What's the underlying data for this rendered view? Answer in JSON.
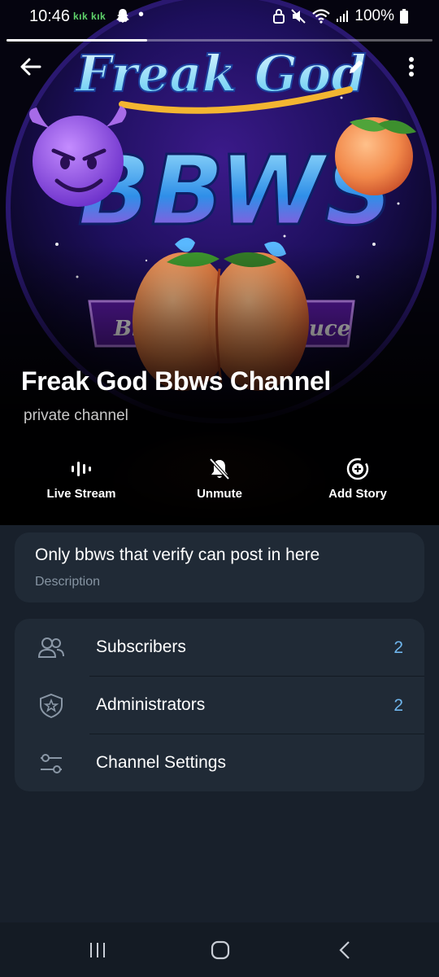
{
  "status_bar": {
    "time": "10:46",
    "kik_badges": "kık kık",
    "battery_text": "100%"
  },
  "story_progress": 0.33,
  "cover_art": {
    "logo_line1": "Freak God",
    "logo_line2": "BBWS",
    "banner_visible_left": "Bl",
    "banner_visible_right": "uce"
  },
  "channel": {
    "name": "Freak God Bbws Channel",
    "type": "private channel"
  },
  "actions": [
    {
      "label": "Live Stream",
      "icon": "live-stream-icon"
    },
    {
      "label": "Unmute",
      "icon": "bell-off-icon"
    },
    {
      "label": "Add Story",
      "icon": "add-story-icon"
    }
  ],
  "description": {
    "text": "Only bbws that verify can post in here",
    "caption": "Description"
  },
  "rows": [
    {
      "label": "Subscribers",
      "count": "2",
      "icon": "people-icon"
    },
    {
      "label": "Administrators",
      "count": "2",
      "icon": "shield-star-icon"
    },
    {
      "label": "Channel Settings",
      "count": "",
      "icon": "sliders-icon"
    }
  ],
  "colors": {
    "accent_count": "#6fb5ec",
    "card_bg": "#202a36",
    "page_bg": "#18202b"
  }
}
